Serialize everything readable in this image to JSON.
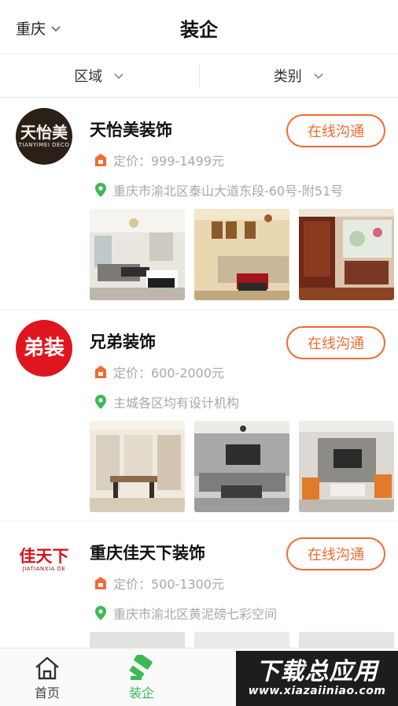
{
  "header": {
    "city": "重庆",
    "title": "装企"
  },
  "filters": [
    {
      "label": "区域"
    },
    {
      "label": "类别"
    }
  ],
  "companies": [
    {
      "name": "天怡美装饰",
      "logo_text": "天怡美",
      "logo_sub": "TIANYIMEI DECO",
      "logo_bg": "#2b2018",
      "logo_fg": "#f3efe6",
      "price": "定价：999-1499元",
      "address": "重庆市渝北区泰山大道东段-60号-附51号",
      "button": "在线沟通"
    },
    {
      "name": "兄弟装饰",
      "logo_text": "弟装",
      "logo_sub": "",
      "logo_bg": "#e0161f",
      "logo_fg": "#ffffff",
      "price": "定价：600-2000元",
      "address": "主城各区均有设计机构",
      "button": "在线沟通"
    },
    {
      "name": "重庆佳天下装饰",
      "logo_text": "佳天下",
      "logo_sub": "JIATIANXIA DE",
      "logo_bg": "#ffffff",
      "logo_fg": "#d7151c",
      "price": "定价：500-1300元",
      "address": "重庆市渝北区黄泥磅七彩空间",
      "button": "在线沟通"
    }
  ],
  "tabs": [
    {
      "label": "首页",
      "icon": "home-icon",
      "active": false
    },
    {
      "label": "装企",
      "icon": "hammer-icon",
      "active": true
    }
  ],
  "watermark": {
    "big": "下载总应用",
    "small": "www.xiazaiiniao.com"
  },
  "colors": {
    "accent": "#f26b32",
    "price_icon": "#f26b32",
    "location_icon": "#3cba54",
    "active_tab": "#3cba54"
  }
}
